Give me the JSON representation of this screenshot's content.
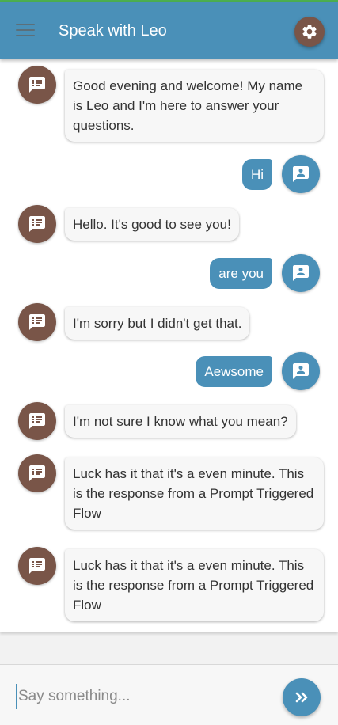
{
  "header": {
    "title": "Speak with Leo",
    "menu_icon": "menu-icon",
    "settings_icon": "gear-icon"
  },
  "colors": {
    "primary": "#4a90b8",
    "bot_avatar": "#795548",
    "accent_top": "#4caf50"
  },
  "messages": [
    {
      "sender": "bot",
      "text": "Good evening and welcome! My name is Leo and I'm here to answer your questions."
    },
    {
      "sender": "user",
      "text": "Hi"
    },
    {
      "sender": "bot",
      "text": "Hello. It's good to see you!"
    },
    {
      "sender": "user",
      "text": "are you"
    },
    {
      "sender": "bot",
      "text": "I'm sorry but I didn't get that."
    },
    {
      "sender": "user",
      "text": "Aewsome"
    },
    {
      "sender": "bot",
      "text": "I'm not sure I know what you mean?"
    },
    {
      "sender": "bot",
      "text": "Luck has it that it's a even minute. This is the response from a Prompt Triggered Flow"
    },
    {
      "sender": "bot",
      "text": "Luck has it that it's a even minute. This is the response from a Prompt Triggered Flow"
    }
  ],
  "input": {
    "placeholder": "Say something...",
    "value": "",
    "send_icon": "double-chevron-right-icon"
  }
}
